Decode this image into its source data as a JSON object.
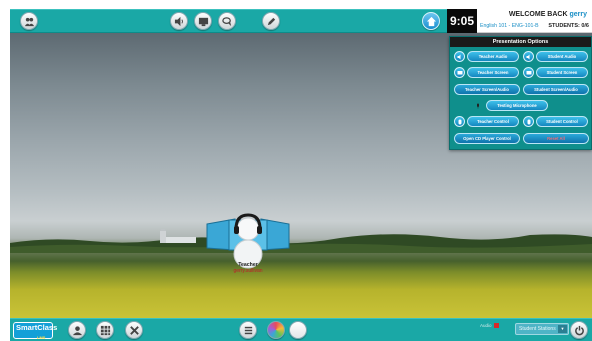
{
  "header": {
    "time": "9:05",
    "welcome_text": "WELCOME BACK",
    "username": "gerry",
    "course": "English 101 - ENG-101-B",
    "students": "STUDENTS: 0/6"
  },
  "toolbar_icons": [
    "group-icon",
    "speaker-icon",
    "monitor-icon",
    "chat-icon",
    "pen-icon",
    "home-icon"
  ],
  "presentation": {
    "title": "Presentation Options",
    "teacher_audio": "Teacher Audio",
    "student_audio": "Student Audio",
    "teacher_screen": "Teacher Screen",
    "student_screen": "Student Screen",
    "teacher_screen_audio": "Teacher Screen/Audio",
    "student_screen_audio": "Student Screen/Audio",
    "testing_microphone": "Testing Microphone",
    "teacher_control": "Teacher Control",
    "student_control": "Student Control",
    "open_cd_player": "Open CD Player Control",
    "reset_all": "Reset All"
  },
  "teacher": {
    "label": "Teacher",
    "username": "gerry.sullivan"
  },
  "bottom": {
    "logo": "SmartClass",
    "logo_tag": "LMS",
    "audio_label": "Audio",
    "student_stations": "Student Stations"
  },
  "colors": {
    "toolbar": "#1aa8a6",
    "panel": "#0f8f8c",
    "button": "#1e9bd4",
    "accent": "#1a8fc6"
  }
}
